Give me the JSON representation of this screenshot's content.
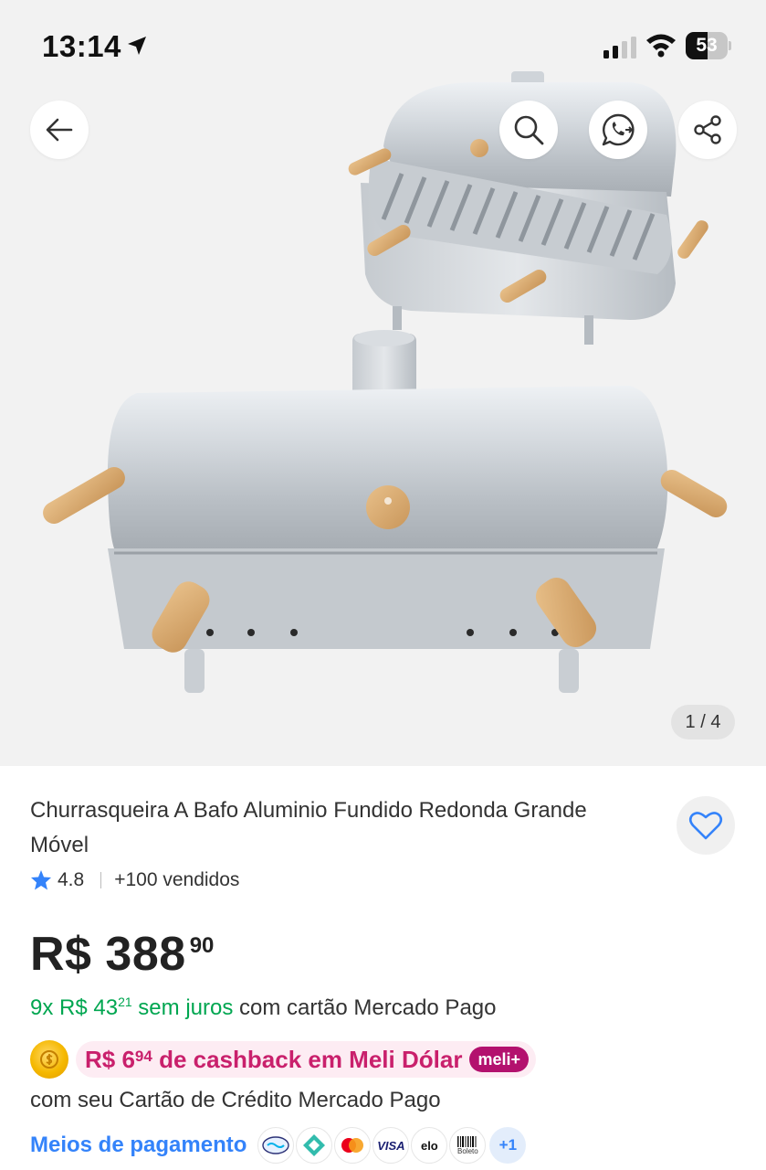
{
  "status_bar": {
    "time": "13:14",
    "battery": "53",
    "battery_level_percent": 53
  },
  "colors": {
    "accent_blue": "#3483fa",
    "installments_green": "#00a650",
    "cashback_pink": "#c9206c",
    "meli_badge": "#b3116e",
    "hero_background": "#f2f2f2"
  },
  "gallery": {
    "counter": "1 / 4",
    "image_description_icon": "grill-product-photo"
  },
  "header_actions": {
    "back_icon": "arrow-left-icon",
    "search_icon": "search-icon",
    "whatsapp_icon": "whatsapp-icon",
    "share_icon": "share-icon"
  },
  "product": {
    "title": "Churrasqueira A Bafo Aluminio Fundido Redonda Grande Móvel",
    "rating": "4.8",
    "sold": "+100 vendidos",
    "price_main": "R$ 388",
    "price_cents": "90",
    "installments": {
      "prefix": "9x R$ 43",
      "cents": "21",
      "suffix": " sem juros",
      "rest": " com cartão Mercado Pago"
    },
    "cashback": {
      "amount": "R$ 6",
      "amount_cents": "94",
      "text": " de cashback em Meli Dólar",
      "badge": "meli+"
    },
    "card_line": "com seu Cartão de Crédito Mercado Pago",
    "payment": {
      "link": "Meios de pagamento",
      "methods": [
        "mercado-pago-icon",
        "pix-icon",
        "mastercard-icon",
        "visa-icon",
        "elo-icon",
        "boleto-icon"
      ],
      "visa_label": "VISA",
      "elo_label": "elo",
      "boleto_label": "Boleto",
      "more": "+1"
    }
  }
}
